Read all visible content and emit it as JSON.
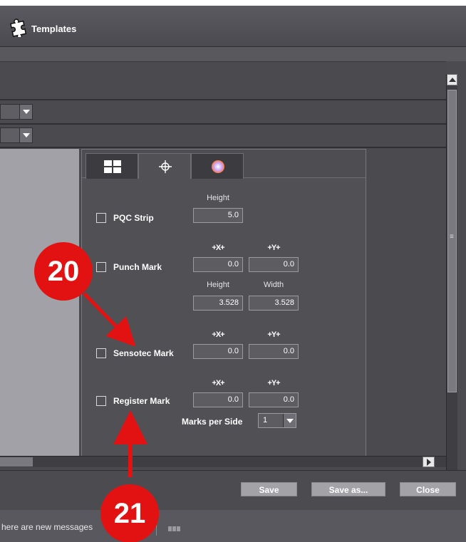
{
  "window": {
    "title": "Templates",
    "title_icon": "puzzle-icon"
  },
  "tabs": [
    {
      "icon": "layout-grid-icon",
      "active": false
    },
    {
      "icon": "crosshair-icon",
      "active": true
    },
    {
      "icon": "color-wheel-icon",
      "active": false
    }
  ],
  "marks": {
    "pqc_strip": {
      "label": "PQC Strip",
      "checked": false,
      "height_label": "Height",
      "height": "5.0"
    },
    "punch_mark": {
      "label": "Punch Mark",
      "checked": false,
      "x_label": "+X+",
      "y_label": "+Y+",
      "x": "0.0",
      "y": "0.0",
      "height_label": "Height",
      "width_label": "Width",
      "height": "3.528",
      "width": "3.528"
    },
    "sensotec_mark": {
      "label": "Sensotec Mark",
      "checked": false,
      "x_label": "+X+",
      "y_label": "+Y+",
      "x": "0.0",
      "y": "0.0"
    },
    "register_mark": {
      "label": "Register Mark",
      "checked": false,
      "x_label": "+X+",
      "y_label": "+Y+",
      "x": "0.0",
      "y": "0.0",
      "marks_per_side_label": "Marks per Side",
      "marks_per_side": "1"
    }
  },
  "footer": {
    "save": "Save",
    "save_as": "Save as...",
    "close": "Close"
  },
  "status": {
    "message": "here are new messages"
  },
  "callouts": {
    "first": "20",
    "second": "21",
    "color": "#e31212"
  }
}
